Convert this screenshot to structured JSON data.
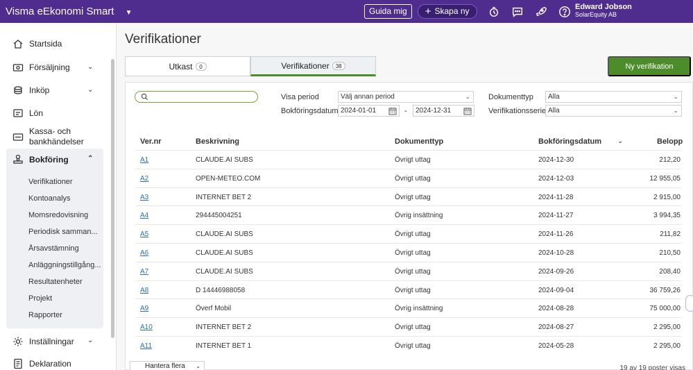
{
  "header": {
    "brand": "Visma eEkonomi Smart",
    "guide_label": "Guida mig",
    "create_label": "Skapa ny",
    "user_name": "Edward Jobson",
    "company": "SolarEquity AB"
  },
  "sidebar": {
    "items": [
      {
        "label": "Startsida"
      },
      {
        "label": "Försäljning"
      },
      {
        "label": "Inköp"
      },
      {
        "label": "Lön"
      },
      {
        "label": "Kassa- och",
        "label2": "bankhändelser"
      },
      {
        "label": "Bokföring"
      },
      {
        "label": "Inställningar"
      },
      {
        "label": "Deklaration"
      }
    ],
    "sub_items": [
      {
        "label": "Verifikationer"
      },
      {
        "label": "Kontoanalys"
      },
      {
        "label": "Momsredovisning"
      },
      {
        "label": "Periodisk samman..."
      },
      {
        "label": "Årsavstämning"
      },
      {
        "label": "Anläggningstillgång..."
      },
      {
        "label": "Resultatenheter"
      },
      {
        "label": "Projekt"
      },
      {
        "label": "Rapporter"
      }
    ]
  },
  "page": {
    "title": "Verifikationer",
    "tabs": [
      {
        "label": "Utkast",
        "count": "0"
      },
      {
        "label": "Verifikationer",
        "count": "38"
      }
    ],
    "new_button": "Ny verifikation"
  },
  "filters": {
    "search_placeholder": "",
    "period_label": "Visa period",
    "period_value": "Välj annan period",
    "date_label": "Bokföringsdatum",
    "date_from": "2024-01-01",
    "date_to": "2024-12-31",
    "doctype_label": "Dokumenttyp",
    "doctype_value": "Alla",
    "series_label": "Verifikationsserie",
    "series_value": "Alla"
  },
  "table": {
    "columns": [
      "Ver.nr",
      "Beskrivning",
      "Dokumenttyp",
      "Bokföringsdatum",
      "Belopp"
    ],
    "rows": [
      {
        "nr": "A1",
        "desc": "CLAUDE.AI SUBS",
        "type": "Övrigt uttag",
        "date": "2024-12-30",
        "amount": "212,20"
      },
      {
        "nr": "A2",
        "desc": "OPEN-METEO.COM",
        "type": "Övrigt uttag",
        "date": "2024-12-03",
        "amount": "12 955,05"
      },
      {
        "nr": "A3",
        "desc": "INTERNET BET 2",
        "type": "Övrigt uttag",
        "date": "2024-11-28",
        "amount": "2 915,00"
      },
      {
        "nr": "A4",
        "desc": "294445004251",
        "type": "Övrig insättning",
        "date": "2024-11-27",
        "amount": "3 994,35"
      },
      {
        "nr": "A5",
        "desc": "CLAUDE.AI SUBS",
        "type": "Övrigt uttag",
        "date": "2024-11-26",
        "amount": "211,82"
      },
      {
        "nr": "A6",
        "desc": "CLAUDE.AI SUBS",
        "type": "Övrigt uttag",
        "date": "2024-10-28",
        "amount": "210,50"
      },
      {
        "nr": "A7",
        "desc": "CLAUDE.AI SUBS",
        "type": "Övrigt uttag",
        "date": "2024-09-26",
        "amount": "208,40"
      },
      {
        "nr": "A8",
        "desc": "D 14446988058",
        "type": "Övrigt uttag",
        "date": "2024-09-04",
        "amount": "36 759,26"
      },
      {
        "nr": "A9",
        "desc": "Överf Mobil",
        "type": "Övrig insättning",
        "date": "2024-08-28",
        "amount": "75 000,00"
      },
      {
        "nr": "A10",
        "desc": "INTERNET BET 2",
        "type": "Övrigt uttag",
        "date": "2024-08-27",
        "amount": "2 295,00"
      },
      {
        "nr": "A11",
        "desc": "INTERNET BET 1",
        "type": "Övrigt uttag",
        "date": "2024-05-28",
        "amount": "2 295,00"
      }
    ]
  },
  "footer": {
    "bulk_label": "Hantera flera",
    "count_text": "19 av 19 poster visas"
  },
  "colors": {
    "topbar": "#4f2d8f",
    "accent_green": "#4c8c2b",
    "link": "#2a6fb8"
  }
}
